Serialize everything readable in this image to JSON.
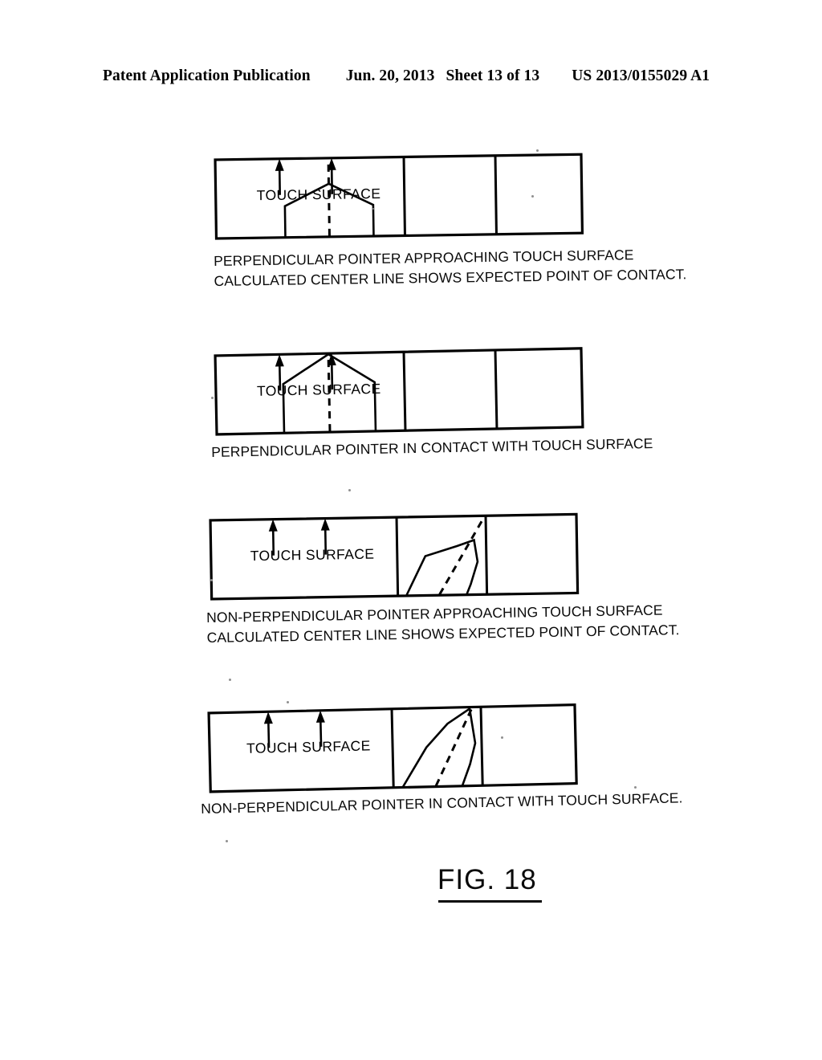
{
  "header": {
    "publication": "Patent Application Publication",
    "date": "Jun. 20, 2013",
    "sheet": "Sheet 13 of 13",
    "patent_number": "US 2013/0155029 A1"
  },
  "figure": {
    "label": "FIG. 18",
    "surface_label": "TOUCH SURFACE"
  },
  "panels": [
    {
      "id": "panel-1",
      "surface_label": "TOUCH SURFACE",
      "pointer_type": "perpendicular",
      "state": "approaching",
      "caption_line1": "PERPENDICULAR POINTER APPROACHING TOUCH SURFACE",
      "caption_line2": "CALCULATED CENTER LINE SHOWS EXPECTED POINT OF CONTACT."
    },
    {
      "id": "panel-2",
      "surface_label": "TOUCH SURFACE",
      "pointer_type": "perpendicular",
      "state": "in-contact",
      "caption_line1": "PERPENDICULAR POINTER IN CONTACT WITH TOUCH SURFACE",
      "caption_line2": ""
    },
    {
      "id": "panel-3",
      "surface_label": "TOUCH SURFACE",
      "pointer_type": "non-perpendicular",
      "state": "approaching",
      "caption_line1": "NON-PERPENDICULAR POINTER APPROACHING TOUCH SURFACE",
      "caption_line2": "CALCULATED CENTER LINE SHOWS EXPECTED POINT OF CONTACT."
    },
    {
      "id": "panel-4",
      "surface_label": "TOUCH SURFACE",
      "pointer_type": "non-perpendicular",
      "state": "in-contact",
      "caption_line1": "NON-PERPENDICULAR POINTER IN CONTACT WITH TOUCH SURFACE.",
      "caption_line2": ""
    }
  ],
  "colors": {
    "ink": "#000000",
    "paper": "#ffffff"
  }
}
